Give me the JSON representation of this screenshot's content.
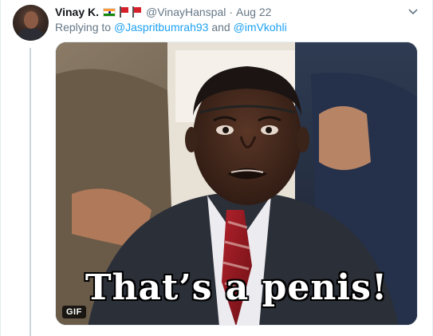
{
  "tweet": {
    "display_name": "Vinay K.",
    "handle": "@VinayHanspal",
    "separator": "·",
    "date": "Aug 22",
    "flag_icons": [
      "india-flag-icon",
      "red-flag-icon",
      "red-flag-icon"
    ],
    "replying_prefix": "Replying to",
    "mentions": [
      "@Jaspritbumrah93",
      "@imVkohli"
    ],
    "mention_joiner": "and",
    "menu_icon": "chevron-down-icon"
  },
  "media": {
    "caption": "That’s a penis!",
    "badge": "GIF"
  },
  "colors": {
    "link": "#1da1f2",
    "secondary_text": "#657786",
    "primary_text": "#14171a",
    "border": "#e6ecf0"
  }
}
